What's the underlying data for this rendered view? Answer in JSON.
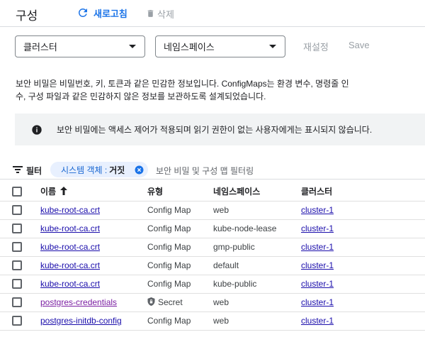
{
  "header": {
    "title": "구성",
    "refresh_label": "새로고침",
    "delete_label": "삭제"
  },
  "filters": {
    "cluster_select": "클러스터",
    "namespace_select": "네임스페이스",
    "reset_label": "재설정",
    "save_label": "Save"
  },
  "description": "보안 비밀은 비밀번호, 키, 토큰과 같은 민감한 정보입니다. ConfigMaps는 환경 변수, 명령줄 인수, 구성 파일과 같은 민감하지 않은 정보를 보관하도록 설계되었습니다.",
  "banner": {
    "text": "보안 비밀에는 액세스 제어가 적용되며 읽기 권한이 없는 사용자에게는 표시되지 않습니다."
  },
  "filter_bar": {
    "label": "필터",
    "chip_key": "시스템 객체 :",
    "chip_value": "거짓",
    "placeholder": "보안 비밀 및 구성 맵 필터링"
  },
  "table": {
    "headers": {
      "name": "이름",
      "type": "유형",
      "namespace": "네임스페이스",
      "cluster": "클러스터"
    },
    "rows": [
      {
        "name": "kube-root-ca.crt",
        "type": "Config Map",
        "namespace": "web",
        "cluster": "cluster-1"
      },
      {
        "name": "kube-root-ca.crt",
        "type": "Config Map",
        "namespace": "kube-node-lease",
        "cluster": "cluster-1"
      },
      {
        "name": "kube-root-ca.crt",
        "type": "Config Map",
        "namespace": "gmp-public",
        "cluster": "cluster-1"
      },
      {
        "name": "kube-root-ca.crt",
        "type": "Config Map",
        "namespace": "default",
        "cluster": "cluster-1"
      },
      {
        "name": "kube-root-ca.crt",
        "type": "Config Map",
        "namespace": "kube-public",
        "cluster": "cluster-1"
      },
      {
        "name": "postgres-credentials",
        "type": "Secret",
        "namespace": "web",
        "cluster": "cluster-1"
      },
      {
        "name": "postgres-initdb-config",
        "type": "Config Map",
        "namespace": "web",
        "cluster": "cluster-1"
      }
    ]
  },
  "colors": {
    "accent": "#1a73e8",
    "link": "#1a0dab",
    "visited_link": "#7b1fa2",
    "chip_bg": "#e8f0fe"
  }
}
